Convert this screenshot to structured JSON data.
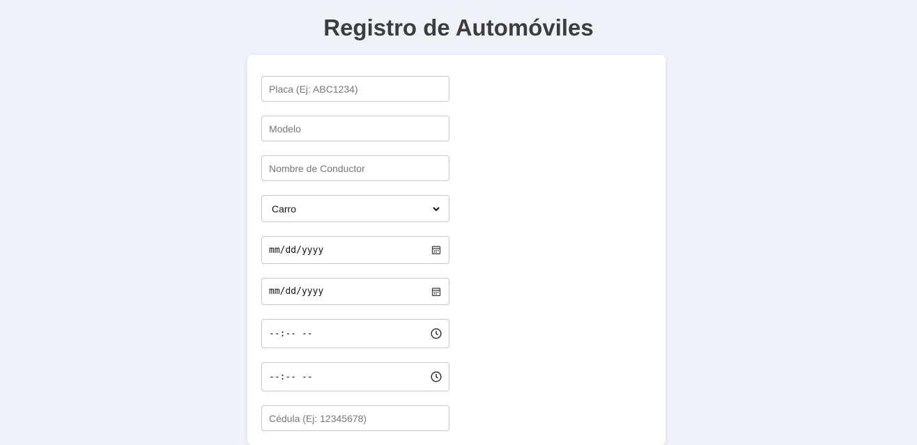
{
  "page": {
    "title": "Registro de Automóviles"
  },
  "form": {
    "placa": {
      "placeholder": "Placa (Ej: ABC1234)"
    },
    "modelo": {
      "placeholder": "Modelo"
    },
    "conductor": {
      "placeholder": "Nombre de Conductor"
    },
    "tipo": {
      "selected": "Carro",
      "icon": "chevron-down-icon"
    },
    "fecha_entrada": {
      "placeholder": "mm/dd/yyyy",
      "icon": "calendar-icon"
    },
    "fecha_salida": {
      "placeholder": "mm/dd/yyyy",
      "icon": "calendar-icon"
    },
    "hora_entrada": {
      "placeholder": "--:-- --",
      "icon": "clock-icon"
    },
    "hora_salida": {
      "placeholder": "--:-- --",
      "icon": "clock-icon"
    },
    "cedula": {
      "placeholder": "Cédula (Ej: 12345678)"
    }
  },
  "colors": {
    "background": "#eff2f7",
    "card": "#ffffff",
    "title": "#3d3d3d",
    "border": "#c8c8c8"
  }
}
